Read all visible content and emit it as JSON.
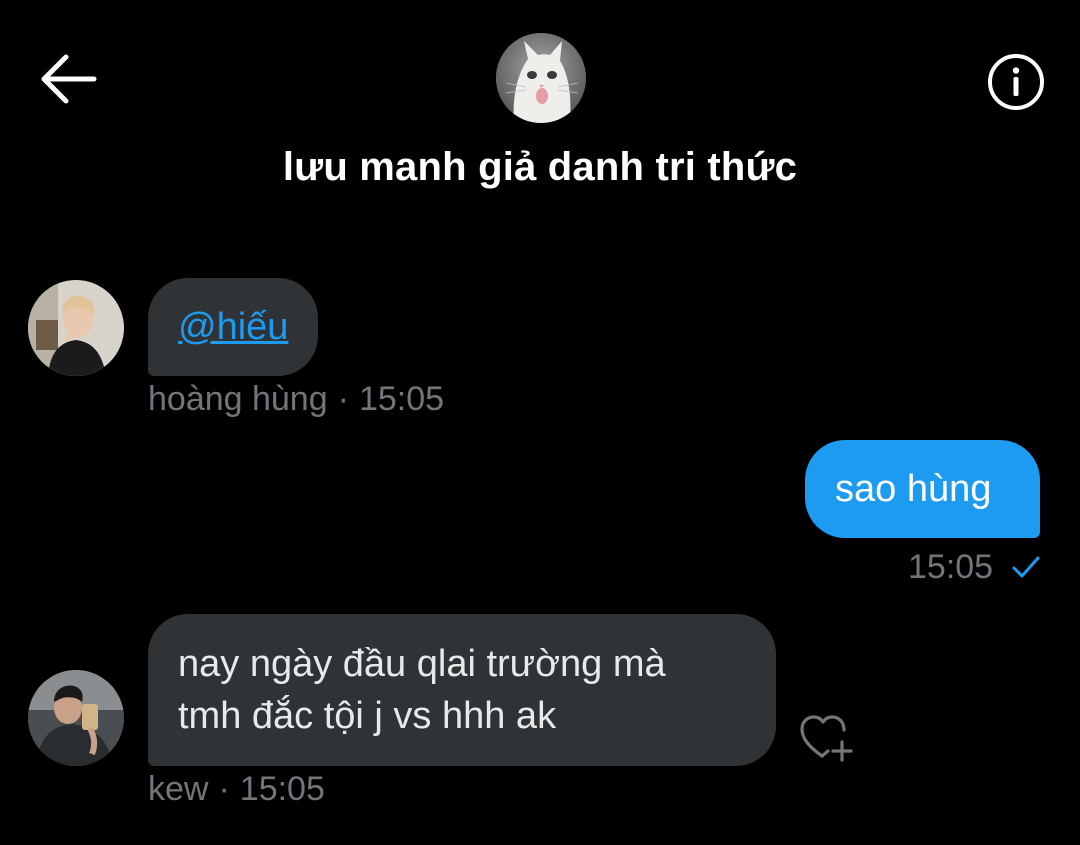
{
  "header": {
    "title": "lưu manh giả danh tri thức",
    "back_icon": "arrow-left-icon",
    "info_icon": "info-circle-icon"
  },
  "messages": [
    {
      "direction": "incoming",
      "mention": "@hiếu",
      "sender": "hoàng hùng",
      "time": "15:05"
    },
    {
      "direction": "outgoing",
      "text": "sao hùng",
      "time": "15:05",
      "status_icon": "sent-check-icon"
    },
    {
      "direction": "incoming",
      "line1": "nay ngày đầu qlai trường mà",
      "line2": "tmh đắc tội j vs hhh ak",
      "sender": "kew",
      "time": "15:05",
      "reaction_icon": "add-reaction-heart-icon"
    }
  ],
  "colors": {
    "background": "#000000",
    "incoming_bubble": "#2f3336",
    "outgoing_bubble": "#1d9bf0",
    "meta_text": "#71767b",
    "accent": "#1d9bf0"
  }
}
